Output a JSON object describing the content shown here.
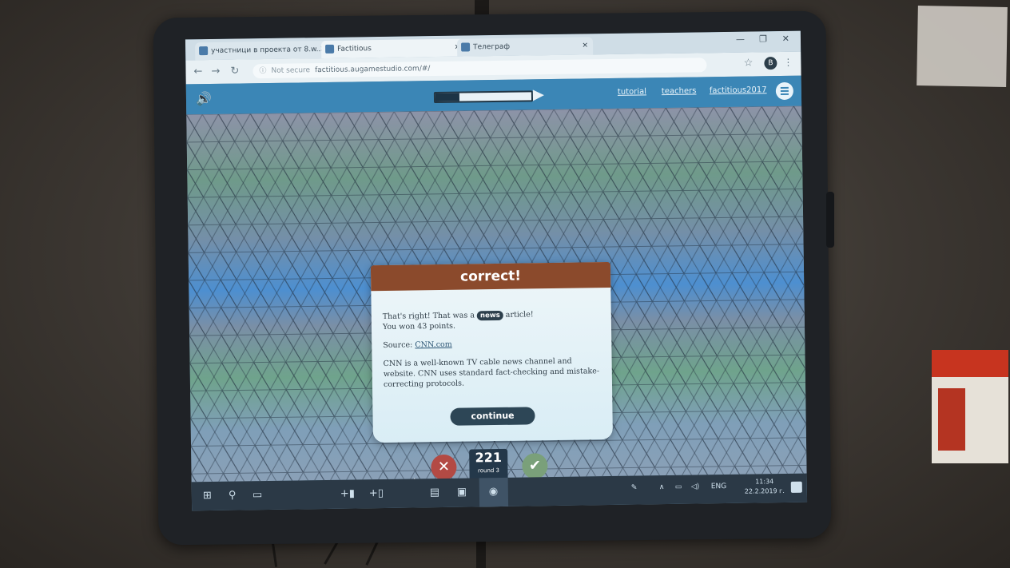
{
  "browser": {
    "tabs": [
      {
        "label": "участници в проекта от 8.w..."
      },
      {
        "label": "Factitious"
      },
      {
        "label": "Телеграф"
      }
    ],
    "url_security": "Not secure",
    "url": "factitious.augamestudio.com/#/",
    "profile_initial": "B"
  },
  "appbar": {
    "nav_links": [
      "tutorial",
      "teachers",
      "factitious2017"
    ]
  },
  "modal": {
    "title": "correct!",
    "line1_before": "That's right! That was a",
    "line1_badge": "news",
    "line1_after": "article!",
    "points_text": "You won 43 points.",
    "source_label": "Source:",
    "source_link": "CNN.com",
    "description": "CNN is a well-known TV cable news channel and website. CNN uses standard fact-checking and mistake-correcting protocols.",
    "continue_label": "continue"
  },
  "scorebar": {
    "score": "221",
    "round": "round 3"
  },
  "taskbar": {
    "language": "ENG",
    "time": "11:34",
    "date": "22.2.2019 г."
  },
  "colors": {
    "appbar": "#3b86b6",
    "modal_header": "#8b4a2c",
    "continue_button": "#2d4656",
    "reject_button": "#b34a44",
    "accept_button": "#7aa07a"
  }
}
